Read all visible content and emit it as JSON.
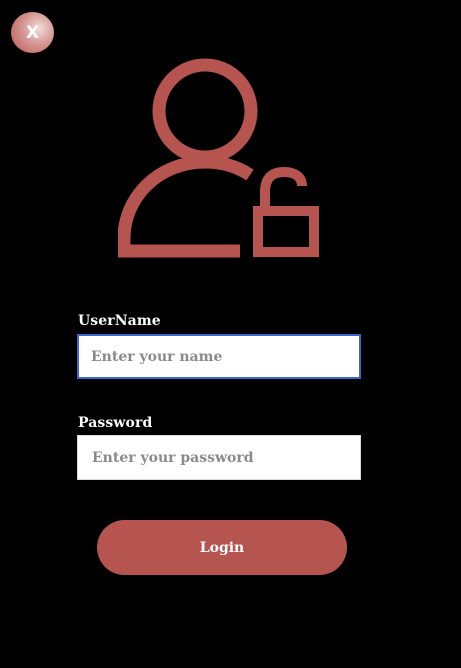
{
  "close_button": {
    "label": "X"
  },
  "form": {
    "username_label": "UserName",
    "username_placeholder": "Enter your name",
    "username_value": "",
    "password_label": "Password",
    "password_placeholder": "Enter your password",
    "password_value": "",
    "login_label": "Login"
  },
  "icons": {
    "user_icon": "user-unlock-icon"
  },
  "colors": {
    "background": "#000000",
    "accent": "#b6544f",
    "focus_border": "#3a66cf",
    "label_text": "#ffffff"
  }
}
